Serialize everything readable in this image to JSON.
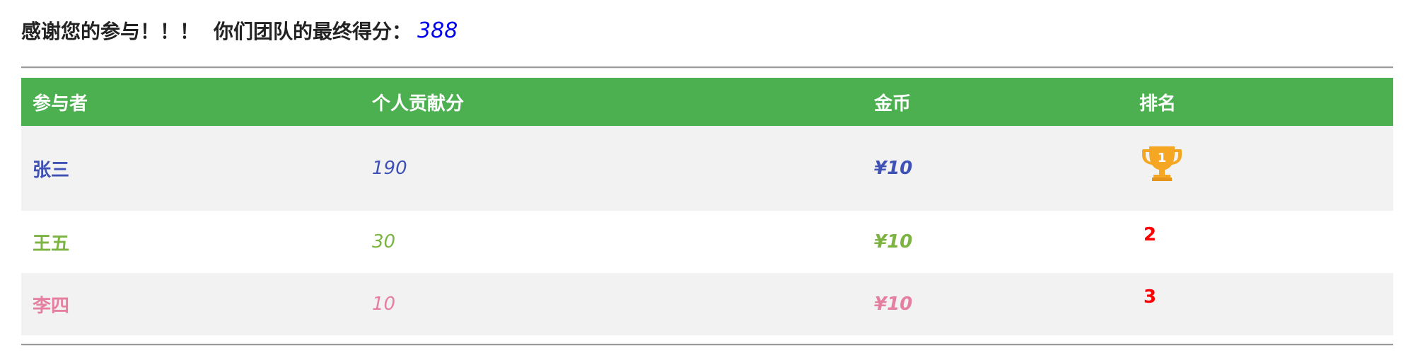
{
  "header": {
    "thanks": "感谢您的参与！！！",
    "final_label": "你们团队的最终得分：",
    "final_score": "388"
  },
  "table": {
    "columns": [
      "参与者",
      "个人贡献分",
      "金币",
      "排名"
    ],
    "rows": [
      {
        "name": "张三",
        "score": "190",
        "coins": "¥10",
        "rank": "1",
        "rank_display": "trophy-icon",
        "color": "#3f51b5"
      },
      {
        "name": "王五",
        "score": "30",
        "coins": "¥10",
        "rank": "2",
        "rank_display": "text",
        "color": "#7cb342"
      },
      {
        "name": "李四",
        "score": "10",
        "coins": "¥10",
        "rank": "3",
        "rank_display": "text",
        "color": "#e57fa0"
      }
    ]
  },
  "colors": {
    "header_bg": "#4caf50",
    "stripe_bg": "#f2f2f2",
    "score_blue": "#0000ee",
    "rank_red": "#ff0000",
    "trophy_gold": "#f5a623"
  }
}
